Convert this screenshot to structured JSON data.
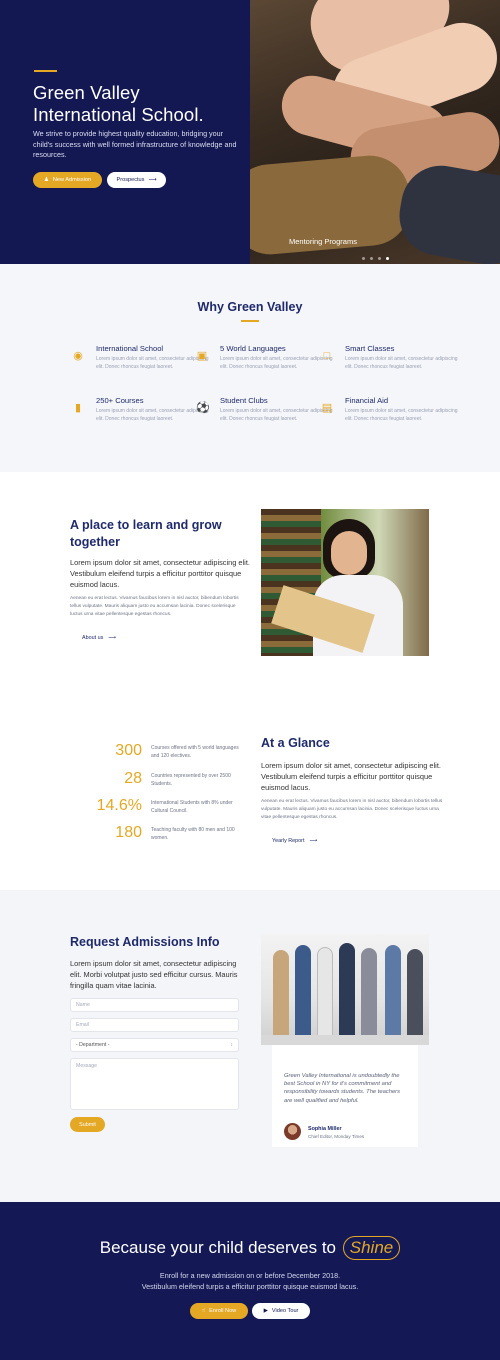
{
  "hero": {
    "title": "Green Valley International School.",
    "text": "We strive to provide highest quality education, bridging your child's success with well formed infrastructure of knowledge and resources.",
    "btn_primary": "New Admission",
    "btn_secondary": "Prospectus",
    "slide_caption": "Mentoring Programs",
    "slide_count": 4,
    "active_slide": 4
  },
  "why": {
    "title": "Why Green Valley",
    "features": [
      {
        "icon": "globe-icon",
        "title": "International School",
        "text": "Lorem ipsum dolor sit amet, consectetur adipiscing elit. Donec rhoncus feugiat laoreet."
      },
      {
        "icon": "language-icon",
        "title": "5 World Languages",
        "text": "Lorem ipsum dolor sit amet, consectetur adipiscing elit. Donec rhoncus feugiat laoreet."
      },
      {
        "icon": "laptop-icon",
        "title": "Smart Classes",
        "text": "Lorem ipsum dolor sit amet, consectetur adipiscing elit. Donec rhoncus feugiat laoreet."
      },
      {
        "icon": "book-icon",
        "title": "250+ Courses",
        "text": "Lorem ipsum dolor sit amet, consectetur adipiscing elit. Donec rhoncus feugiat laoreet."
      },
      {
        "icon": "ball-icon",
        "title": "Student Clubs",
        "text": "Lorem ipsum dolor sit amet, consectetur adipiscing elit. Donec rhoncus feugiat laoreet."
      },
      {
        "icon": "money-icon",
        "title": "Financial Aid",
        "text": "Lorem ipsum dolor sit amet, consectetur adipiscing elit. Donec rhoncus feugiat laoreet."
      }
    ]
  },
  "learn": {
    "title": "A place to learn and grow together",
    "lead": "Lorem ipsum dolor sit amet, consectetur adipiscing elit. Vestibulum eleifend turpis a efficitur porttitor quisque euismod lacus.",
    "text": "Aenean eu erat lectus. Vivamus faucibus lorem in nisl auctor, bibendum lobortis tellus vulputate. Mauris aliquam justo eu accumsan lacinia. Donec scelerisque luctus urna vitae pellentesque egestas rhoncus.",
    "link": "About us"
  },
  "glance": {
    "stats": [
      {
        "number": "300",
        "text": "Courses offered with 5 world languages and 120 electives."
      },
      {
        "number": "28",
        "text": "Countries represented by over 2500 Students."
      },
      {
        "number": "14.6%",
        "text": "International Students with 8% under Cultural Council."
      },
      {
        "number": "180",
        "text": "Teaching faculty with 80 men and 100 women."
      }
    ],
    "title": "At a Glance",
    "lead": "Lorem ipsum dolor sit amet, consectetur adipiscing elit. Vestibulum eleifend turpis a efficitur porttitor quisque euismod lacus.",
    "text": "Aenean eu erat lectus. Vivamus faucibus lorem in nisl auctor, bibendum lobortis tellus vulputate. Mauris aliquam justo eu accumsan lacinia. Donec scelerisque luctus urna vitae pellentesque egestas rhoncus.",
    "link": "Yearly Report"
  },
  "admissions": {
    "title": "Request Admissions Info",
    "lead": "Lorem ipsum dolor sit amet, consectetur adipiscing elit. Morbi volutpat justo sed efficitur cursus. Mauris fringilla quam vitae lacinia.",
    "name_placeholder": "Name",
    "email_placeholder": "Email",
    "department_value": "- Department -",
    "message_placeholder": "Message",
    "submit": "Submit",
    "quote": "Green Valley International is undoubtedly the best School in NY for it's commitment and responsibility towards students. The teachers are well qualified and helpful.",
    "quote_name": "Sophia Miller",
    "quote_role": "Chief Editor, Monday Times"
  },
  "cta": {
    "title": "Because your child deserves to",
    "highlight": "Shine",
    "text_line1": "Enroll for a new admission on or before December 2018.",
    "text_line2": "Vestibulum eleifend turpis a efficitur porttitor quisque euismod lacus.",
    "btn_primary": "Enroll Now",
    "btn_secondary": "Video Tour"
  },
  "colors": {
    "navy": "#131752",
    "gold": "#e4a825",
    "heading": "#1f2a6b"
  }
}
